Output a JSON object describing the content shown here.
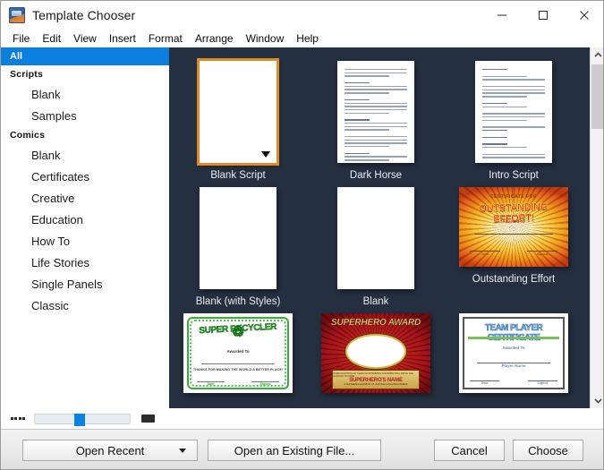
{
  "window": {
    "title": "Template Chooser",
    "icon": "app-icon",
    "controls": [
      {
        "name": "minimize",
        "glyph": "minimize-icon"
      },
      {
        "name": "maximize",
        "glyph": "maximize-icon"
      },
      {
        "name": "close",
        "glyph": "close-icon"
      }
    ]
  },
  "menubar": {
    "items": [
      {
        "label": "File"
      },
      {
        "label": "Edit"
      },
      {
        "label": "View"
      },
      {
        "label": "Insert"
      },
      {
        "label": "Format"
      },
      {
        "label": "Arrange"
      },
      {
        "label": "Window"
      },
      {
        "label": "Help"
      }
    ]
  },
  "sidebar": {
    "selected": "All",
    "items": [
      {
        "label": "All",
        "type": "selected"
      },
      {
        "label": "Scripts",
        "type": "group"
      },
      {
        "label": "Blank",
        "type": "child"
      },
      {
        "label": "Samples",
        "type": "child"
      },
      {
        "label": "Comics",
        "type": "group"
      },
      {
        "label": "Blank",
        "type": "child"
      },
      {
        "label": "Certificates",
        "type": "child"
      },
      {
        "label": "Creative",
        "type": "child"
      },
      {
        "label": "Education",
        "type": "child"
      },
      {
        "label": "How To",
        "type": "child"
      },
      {
        "label": "Life Stories",
        "type": "child"
      },
      {
        "label": "Single Panels",
        "type": "child"
      },
      {
        "label": "Classic",
        "type": "child"
      }
    ]
  },
  "gallery": {
    "background_color": "#242f40",
    "selection_color": "#e08a2a",
    "templates": [
      {
        "label": "Blank Script",
        "kind": "blank-portrait",
        "selected": true
      },
      {
        "label": "Dark Horse",
        "kind": "text-page",
        "selected": false
      },
      {
        "label": "Intro Script",
        "kind": "text-page",
        "selected": false
      },
      {
        "label": "Blank (with Styles)",
        "kind": "blank-portrait",
        "selected": false
      },
      {
        "label": "Blank",
        "kind": "blank-portrait",
        "selected": false
      },
      {
        "label": "Outstanding Effort",
        "kind": "cert-outstanding",
        "selected": false
      },
      {
        "label": "",
        "kind": "cert-recycler",
        "selected": false
      },
      {
        "label": "",
        "kind": "cert-superhero",
        "selected": false
      },
      {
        "label": "",
        "kind": "cert-teamplayer",
        "selected": false
      }
    ],
    "certificate_text": {
      "outstanding": {
        "top": "CERTIFICATE  FOR",
        "main": "OUTSTANDING EFFORT!",
        "sub": "Awarded To",
        "left_label": "Date",
        "right_label": "Signed"
      },
      "recycler": {
        "title_left": "SUPER",
        "title_right": "RECYCLER",
        "sub": "Awarded To",
        "message": "THANKS FOR MAKING THE WORLD A BETTER PLACE!",
        "left_label": "Date",
        "right_label": "Signed"
      },
      "superhero": {
        "title": "SUPERHERO AWARD",
        "band_top": "IN RECOGNITION OF THEIR OUTSTANDING CONTRIBUTION, WE'VE THE HONOUR TO NAME",
        "band_main": "SUPERHERO'S NAME",
        "band_bottom": "A SUPREME CHAMPION OF JUSTICE & RIGHTEOUSNESS"
      },
      "teamplayer": {
        "title": "TEAM PLAYER CERTIFICATE",
        "sub": "Awarded To",
        "name": "Player Name",
        "left_label": "Date",
        "right_label": "Signed"
      }
    }
  },
  "scrollbar": {
    "up_icon": "chevron-up-icon",
    "down_icon": "chevron-down-icon",
    "thumb_position": "near-top"
  },
  "zoom_controls": {
    "small_icon": "small-thumbnails-icon",
    "large_icon": "large-thumbnails-icon",
    "slider_value": 42
  },
  "bottombar": {
    "open_recent_label": "Open Recent",
    "open_recent_caret": "chevron-down-icon",
    "open_existing_label": "Open an Existing File...",
    "cancel_label": "Cancel",
    "choose_label": "Choose"
  }
}
